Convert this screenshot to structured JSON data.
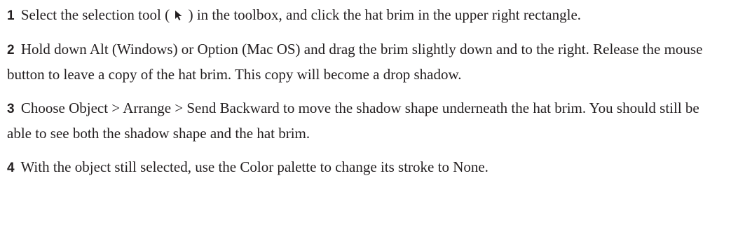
{
  "steps": [
    {
      "number": "1",
      "text_before_icon": "Select the selection tool (",
      "icon": "selection-tool-arrow-icon",
      "text_after_icon": ") in the toolbox, and click the hat brim in the upper right rectangle."
    },
    {
      "number": "2",
      "text": "Hold down Alt (Windows) or Option (Mac OS) and drag the brim slightly down and to the right. Release the mouse button to leave a copy of the hat brim. This copy will become a drop shadow."
    },
    {
      "number": "3",
      "text": "Choose Object > Arrange > Send Backward to move the shadow shape underneath the hat brim. You should still be able to see both the shadow shape and the hat brim."
    },
    {
      "number": "4",
      "text": "With the object still selected, use the Color palette to change its stroke to None."
    }
  ]
}
